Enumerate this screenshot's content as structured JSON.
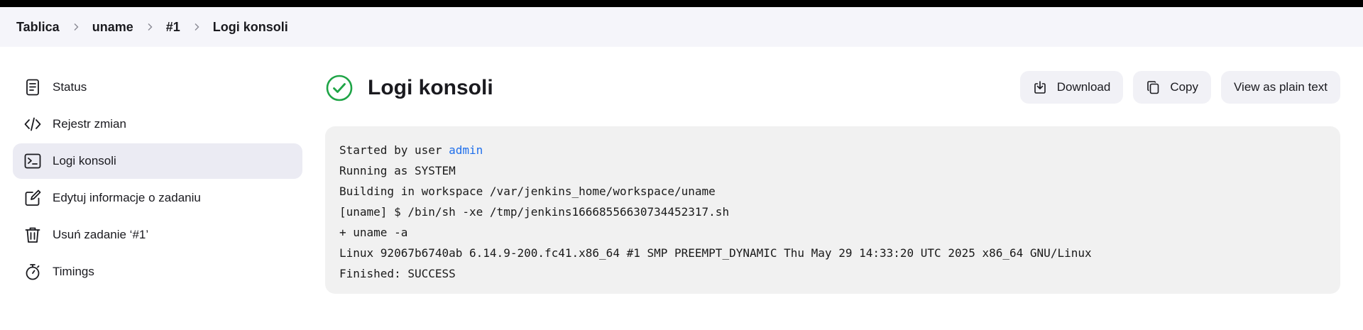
{
  "breadcrumb": {
    "items": [
      "Tablica",
      "uname",
      "#1",
      "Logi konsoli"
    ]
  },
  "sidebar": {
    "items": [
      {
        "label": "Status",
        "icon": "document-icon"
      },
      {
        "label": "Rejestr zmian",
        "icon": "code-icon"
      },
      {
        "label": "Logi konsoli",
        "icon": "terminal-icon",
        "active": true
      },
      {
        "label": "Edytuj informacje o zadaniu",
        "icon": "edit-icon"
      },
      {
        "label": "Usuń zadanie ‘#1’",
        "icon": "trash-icon"
      },
      {
        "label": "Timings",
        "icon": "stopwatch-icon"
      }
    ]
  },
  "header": {
    "title": "Logi konsoli",
    "status_icon": "success-check-icon",
    "status_color": "#1ea446"
  },
  "actions": {
    "download_label": "Download",
    "copy_label": "Copy",
    "plain_text_label": "View as plain text"
  },
  "console": {
    "started_prefix": "Started by user ",
    "started_user": "admin",
    "lines": [
      "Running as SYSTEM",
      "Building in workspace /var/jenkins_home/workspace/uname",
      "[uname] $ /bin/sh -xe /tmp/jenkins16668556630734452317.sh",
      "+ uname -a",
      "Linux 92067b6740ab 6.14.9-200.fc41.x86_64 #1 SMP PREEMPT_DYNAMIC Thu May 29 14:33:20 UTC 2025 x86_64 GNU/Linux",
      "Finished: SUCCESS"
    ],
    "link_color": "#1f6feb"
  }
}
